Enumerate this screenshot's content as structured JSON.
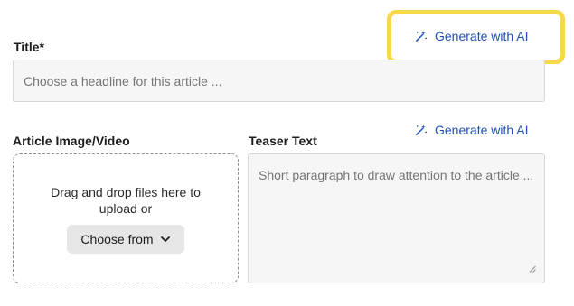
{
  "title_field": {
    "label": "Title*",
    "placeholder": "Choose a headline for this article ..."
  },
  "generate_buttons": {
    "title": {
      "label": "Generate with AI",
      "icon": "magic-wand-icon"
    },
    "teaser": {
      "label": "Generate with AI",
      "icon": "magic-wand-icon"
    }
  },
  "article_media": {
    "label": "Article Image/Video",
    "dropzone_text": "Drag and drop files here to upload or",
    "choose_button": "Choose from",
    "choose_icon": "chevron-down-icon"
  },
  "teaser_field": {
    "label": "Teaser Text",
    "placeholder": "Short paragraph to draw attention to the article ..."
  },
  "colors": {
    "accent": "#1f4fb8",
    "highlight": "#f5d94a",
    "input_bg": "#f6f6f6"
  }
}
